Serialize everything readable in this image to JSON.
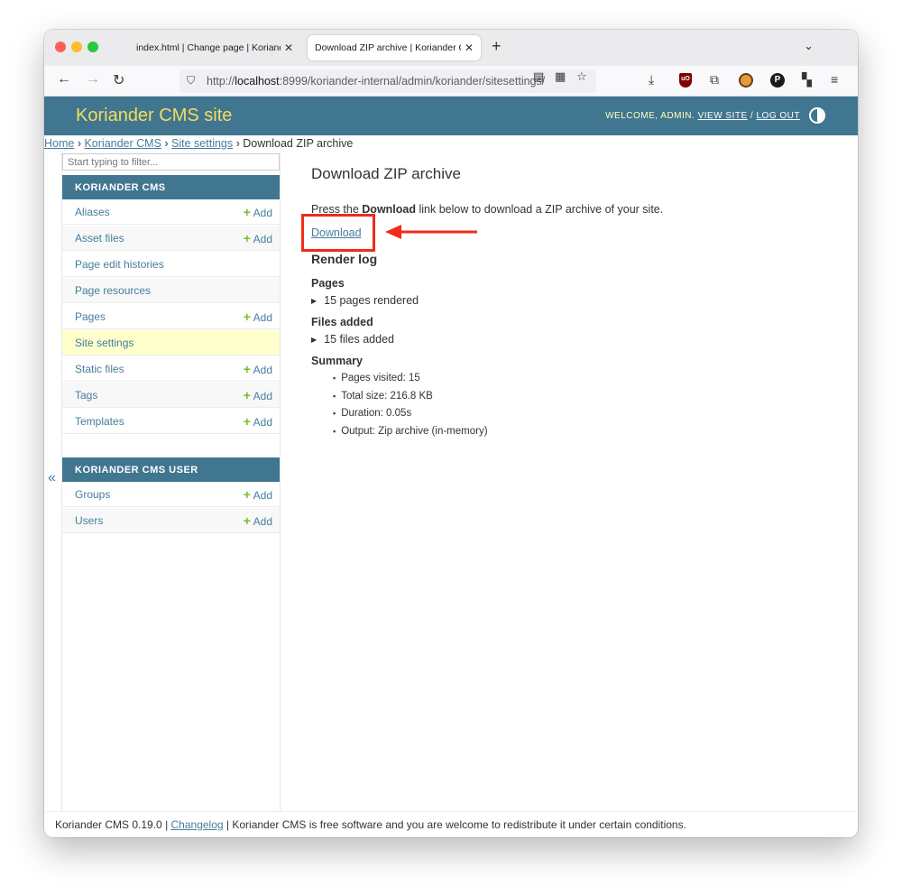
{
  "browser": {
    "tabs": [
      {
        "title": "index.html | Change page | Koriander CMS",
        "active": false
      },
      {
        "title": "Download ZIP archive | Koriander CMS",
        "active": true
      }
    ],
    "url_prefix": "http://",
    "url_host": "localhost",
    "url_rest": ":8999/koriander-internal/admin/koriander/sitesettings/"
  },
  "header": {
    "site_title": "Koriander CMS site",
    "welcome": "WELCOME,",
    "username": "ADMIN",
    "view_site": "VIEW SITE",
    "log_out": "LOG OUT",
    "title_color": "#f5dd5d",
    "bar_color": "#417690"
  },
  "breadcrumbs": {
    "home": "Home",
    "app": "Koriander CMS",
    "model": "Site settings",
    "current": "Download ZIP archive"
  },
  "sidebar": {
    "filter_placeholder": "Start typing to filter...",
    "modules": [
      {
        "caption": "KORIANDER CMS",
        "models": [
          {
            "name": "Aliases",
            "add": "Add"
          },
          {
            "name": "Asset files",
            "add": "Add"
          },
          {
            "name": "Page edit histories",
            "add": ""
          },
          {
            "name": "Page resources",
            "add": ""
          },
          {
            "name": "Pages",
            "add": "Add"
          },
          {
            "name": "Site settings",
            "add": "",
            "selected": true
          },
          {
            "name": "Static files",
            "add": "Add"
          },
          {
            "name": "Tags",
            "add": "Add"
          },
          {
            "name": "Templates",
            "add": "Add"
          }
        ]
      },
      {
        "caption": "KORIANDER CMS USER",
        "models": [
          {
            "name": "Groups",
            "add": "Add"
          },
          {
            "name": "Users",
            "add": "Add"
          }
        ]
      }
    ],
    "collapse_glyph": "«"
  },
  "content": {
    "title": "Download ZIP archive",
    "intro_before": "Press the ",
    "intro_bold": "Download",
    "intro_after": " link below to download a ZIP archive of your site.",
    "download_link": "Download",
    "render_log_heading": "Render log",
    "pages_heading": "Pages",
    "pages_summary": "15 pages rendered",
    "files_heading": "Files added",
    "files_summary": "15 files added",
    "summary_heading": "Summary",
    "summary_items": [
      "Pages visited: 15",
      "Total size: 216.8 KB",
      "Duration: 0.05s",
      "Output: Zip archive (in-memory)"
    ],
    "highlight_color": "#ee2c1c"
  },
  "footer": {
    "before": "Koriander CMS 0.19.0 | ",
    "changelog": "Changelog",
    "after": " | Koriander CMS is free software and you are welcome to redistribute it under certain conditions."
  }
}
